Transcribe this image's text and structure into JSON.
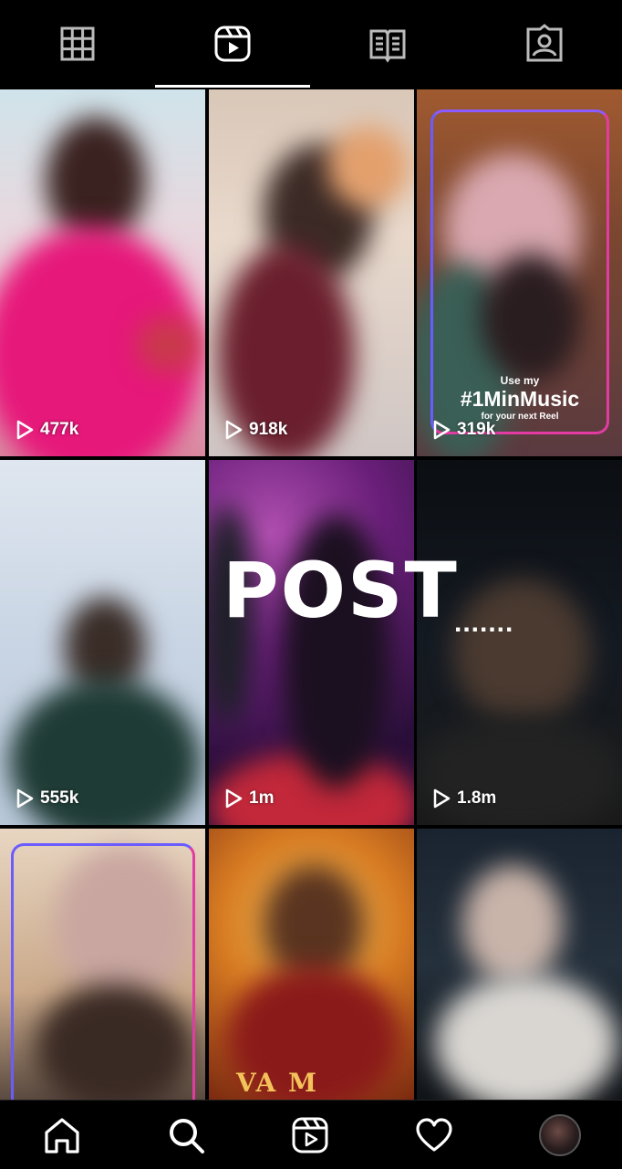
{
  "top_tabs": [
    {
      "name": "posts-grid",
      "icon": "grid-icon"
    },
    {
      "name": "reels",
      "icon": "reels-icon",
      "selected": true
    },
    {
      "name": "guides",
      "icon": "guide-book-icon"
    },
    {
      "name": "tagged",
      "icon": "tagged-person-icon"
    }
  ],
  "reels": [
    {
      "views": "477k"
    },
    {
      "views": "918k"
    },
    {
      "views": "319k",
      "promo": {
        "line1": "Use my",
        "hashtag": "#1MinMusic",
        "line2": "for your next Reel"
      }
    },
    {
      "views": "555k"
    },
    {
      "views": "1m"
    },
    {
      "views": "1.8m"
    },
    {
      "views": ""
    },
    {
      "views": "",
      "caption": "VA  M"
    },
    {
      "views": ""
    }
  ],
  "overlay": {
    "post_text": "POST",
    "dots_text": "......."
  },
  "bottom_nav": [
    {
      "name": "home",
      "icon": "home-icon"
    },
    {
      "name": "search",
      "icon": "search-icon"
    },
    {
      "name": "reels",
      "icon": "reels-icon"
    },
    {
      "name": "activity",
      "icon": "heart-icon"
    },
    {
      "name": "profile",
      "icon": "avatar"
    }
  ],
  "colors": {
    "background": "#000000",
    "foreground": "#ffffff",
    "frame_gradient_top": "#6a5cff",
    "frame_gradient_bottom": "#e23ba4"
  }
}
